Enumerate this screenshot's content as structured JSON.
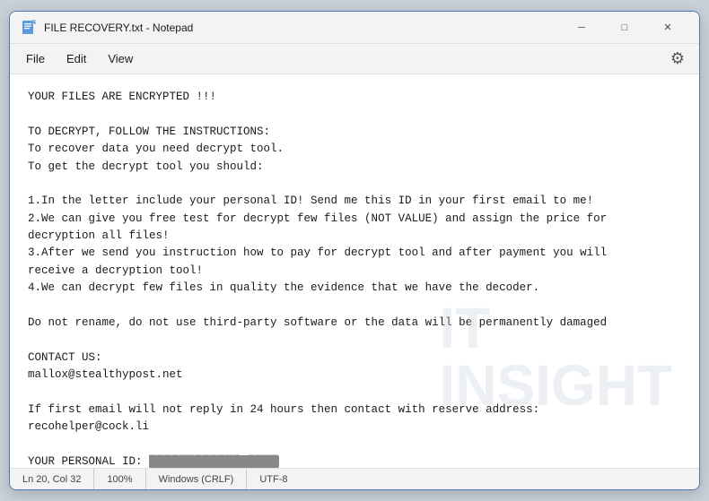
{
  "window": {
    "title": "FILE RECOVERY.txt - Notepad",
    "icon": "notepad"
  },
  "titlebar": {
    "minimize_label": "─",
    "maximize_label": "□",
    "close_label": "✕"
  },
  "menubar": {
    "items": [
      "File",
      "Edit",
      "View"
    ],
    "settings_icon": "⚙"
  },
  "content": {
    "line1": "YOUR FILES ARE ENCRYPTED !!!",
    "line2": "",
    "line3": "TO DECRYPT, FOLLOW THE INSTRUCTIONS:",
    "line4": "To recover data you need decrypt tool.",
    "line5": "To get the decrypt tool you should:",
    "line6": "",
    "line7": "1.In the letter include your personal ID! Send me this ID in your first email to me!",
    "line8": "2.We can give you free test for decrypt few files (NOT VALUE) and assign the price for",
    "line9": "decryption all files!",
    "line10": "3.After we send you instruction how to pay for decrypt tool and after payment you will",
    "line11": "receive a decryption tool!",
    "line12": "4.We can decrypt few files in quality the evidence that we have the decoder.",
    "line13": "",
    "line14": "Do not rename, do not use third-party software or the data will be permanently damaged",
    "line15": "",
    "line16": "CONTACT US:",
    "line17": "mallox@stealthypost.net",
    "line18": "",
    "line19": "If first email will not reply in 24 hours then contact with reserve address:",
    "line20": "recohelper@cock.li",
    "line21": "",
    "line22": "YOUR PERSONAL ID:",
    "personal_id_redacted": "████████████ ████"
  },
  "statusbar": {
    "position": "Ln 20, Col 32",
    "zoom": "100%",
    "line_ending": "Windows (CRLF)",
    "encoding": "UTF-8"
  },
  "watermark": {
    "line1": "IT",
    "line2": "INSIGHT"
  }
}
